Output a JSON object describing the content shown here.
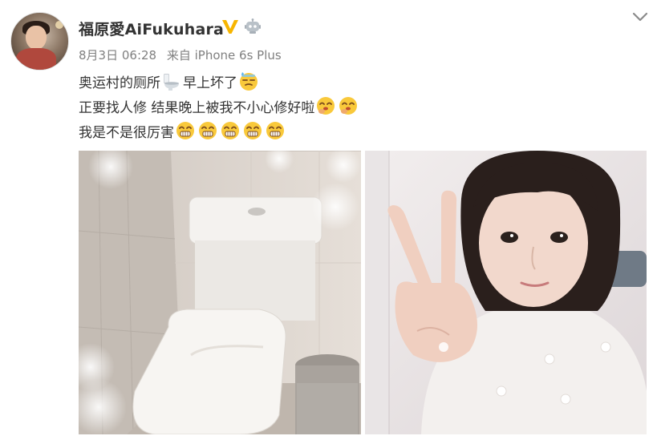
{
  "post": {
    "author": {
      "name": "福原愛AiFukuhara",
      "verified_badge": "v-verified-icon",
      "member_badge": "robot-icon"
    },
    "meta": {
      "date": "8月3日 06:28",
      "source": "来自 iPhone 6s Plus"
    },
    "lines": {
      "line1_a": "奥运村的厕所",
      "line1_b": "早上坏了",
      "line2": "正要找人修 结果晚上被我不小心修好啦",
      "line3": "我是不是很厉害"
    },
    "photos": [
      {
        "description_icon": "toilet-photo"
      },
      {
        "description_icon": "selfie-photo"
      }
    ]
  },
  "colors": {
    "text": "#333333",
    "meta": "#808080",
    "badge_gold": "#f7b500",
    "emoji_yellow": "#f9c93b"
  }
}
